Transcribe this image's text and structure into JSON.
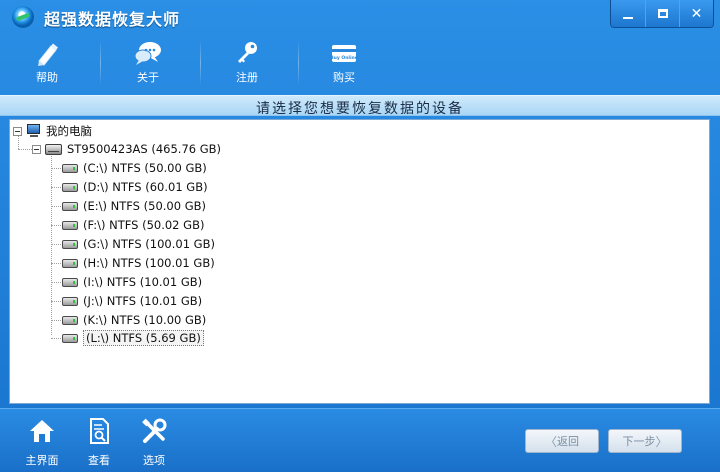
{
  "window": {
    "title": "超强数据恢复大师",
    "controls": {
      "minimize": "minimize-icon",
      "maximize": "maximize-icon",
      "close": "✕"
    }
  },
  "toolbar": {
    "items": [
      {
        "label": "帮助",
        "icon": "pencil-icon"
      },
      {
        "label": "关于",
        "icon": "chat-bubbles-icon"
      },
      {
        "label": "注册",
        "icon": "key-icon"
      },
      {
        "label": "购买",
        "icon": "card-icon",
        "card_text": "Buy Online"
      }
    ]
  },
  "main": {
    "heading": "请选择您想要恢复数据的设备"
  },
  "tree": {
    "root": {
      "label": "我的电脑",
      "expander": "−"
    },
    "disk": {
      "label": "ST9500423AS (465.76 GB)",
      "expander": "−"
    },
    "partitions": [
      "(C:\\) NTFS (50.00 GB)",
      "(D:\\) NTFS (60.01 GB)",
      "(E:\\) NTFS (50.00 GB)",
      "(F:\\) NTFS (50.02 GB)",
      "(G:\\) NTFS (100.01 GB)",
      "(H:\\) NTFS (100.01 GB)",
      "(I:\\) NTFS (10.01 GB)",
      "(J:\\) NTFS (10.01 GB)",
      "(K:\\) NTFS (10.00 GB)",
      "(L:\\) NTFS (5.69 GB)"
    ],
    "selected_partition": "(L:\\) NTFS (5.69 GB)"
  },
  "bottom": {
    "tools": [
      {
        "label": "主界面",
        "icon": "home-icon"
      },
      {
        "label": "查看",
        "icon": "document-search-icon"
      },
      {
        "label": "选项",
        "icon": "tools-icon"
      }
    ],
    "back_label": "返回",
    "back_arrow": "〈",
    "next_label": "下一步",
    "next_arrow": "〉"
  },
  "colors": {
    "titlebar": "#1d7ad3",
    "heading_band": "#bfe1f8",
    "panel_border": "#7ea9d3"
  }
}
